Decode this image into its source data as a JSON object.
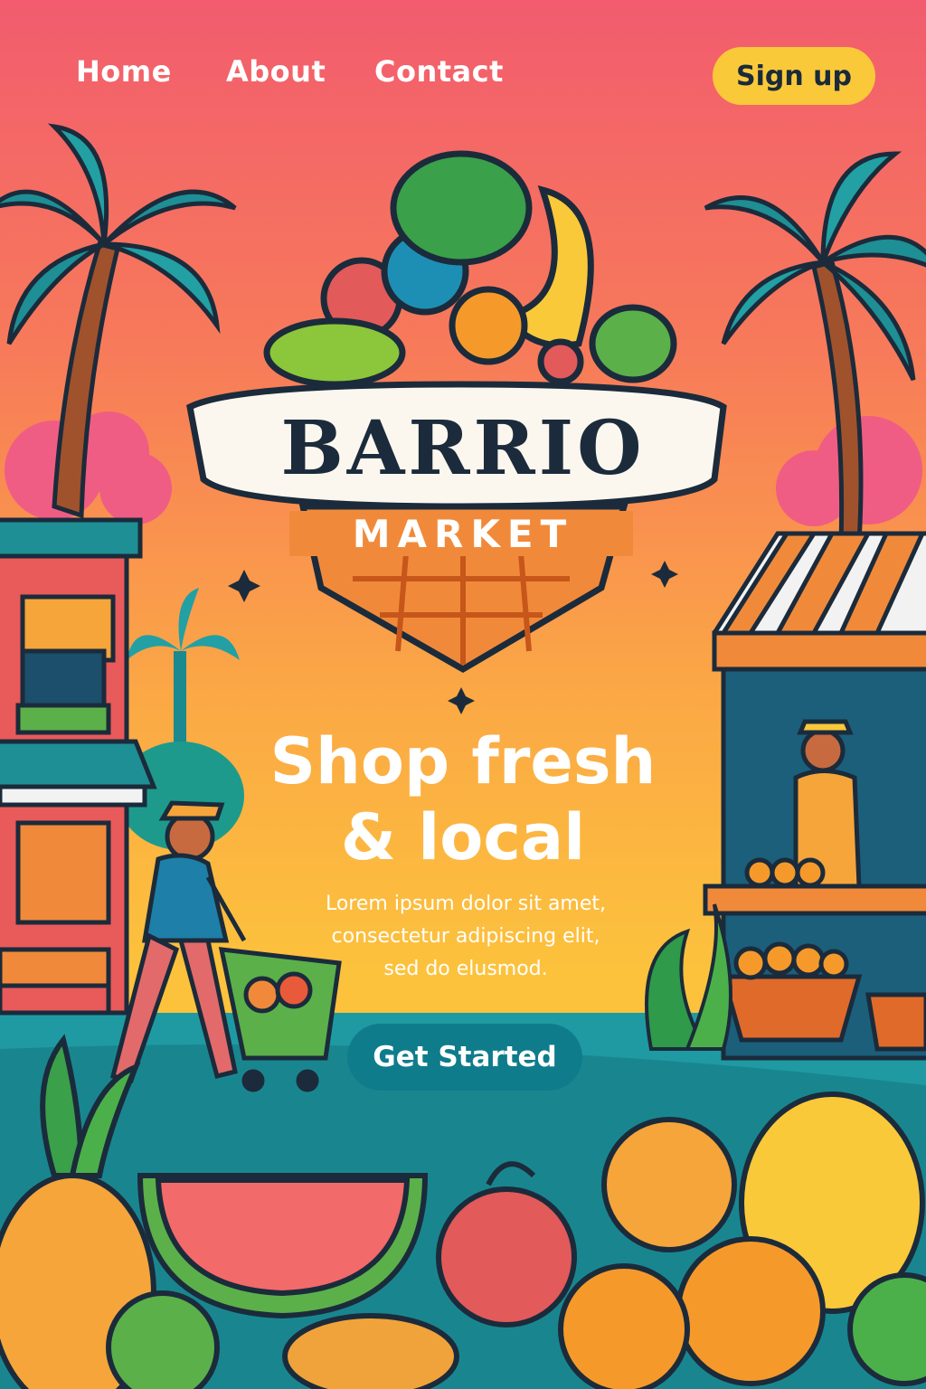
{
  "nav": {
    "links": [
      "Home",
      "About",
      "Contact"
    ],
    "signup_label": "Sign up"
  },
  "logo": {
    "word1": "BARRIO",
    "word2": "MARKET"
  },
  "hero": {
    "headline_line1": "Shop fresh",
    "headline_line2": "& local",
    "body_line1": "Lorem ipsum dolor sit amet,",
    "body_line2": "consectetur adipiscing elit,",
    "body_line3": "sed do elusmod.",
    "cta_label": "Get Started"
  },
  "colors": {
    "sky_top": "#f25c6e",
    "sky_mid": "#f98e4e",
    "sky_bottom": "#fbc541",
    "street": "#1f9aa2",
    "signup_button": "#f9c93a",
    "cta_button": "#0f7c8c",
    "logo_text": "#1b2b3b"
  }
}
